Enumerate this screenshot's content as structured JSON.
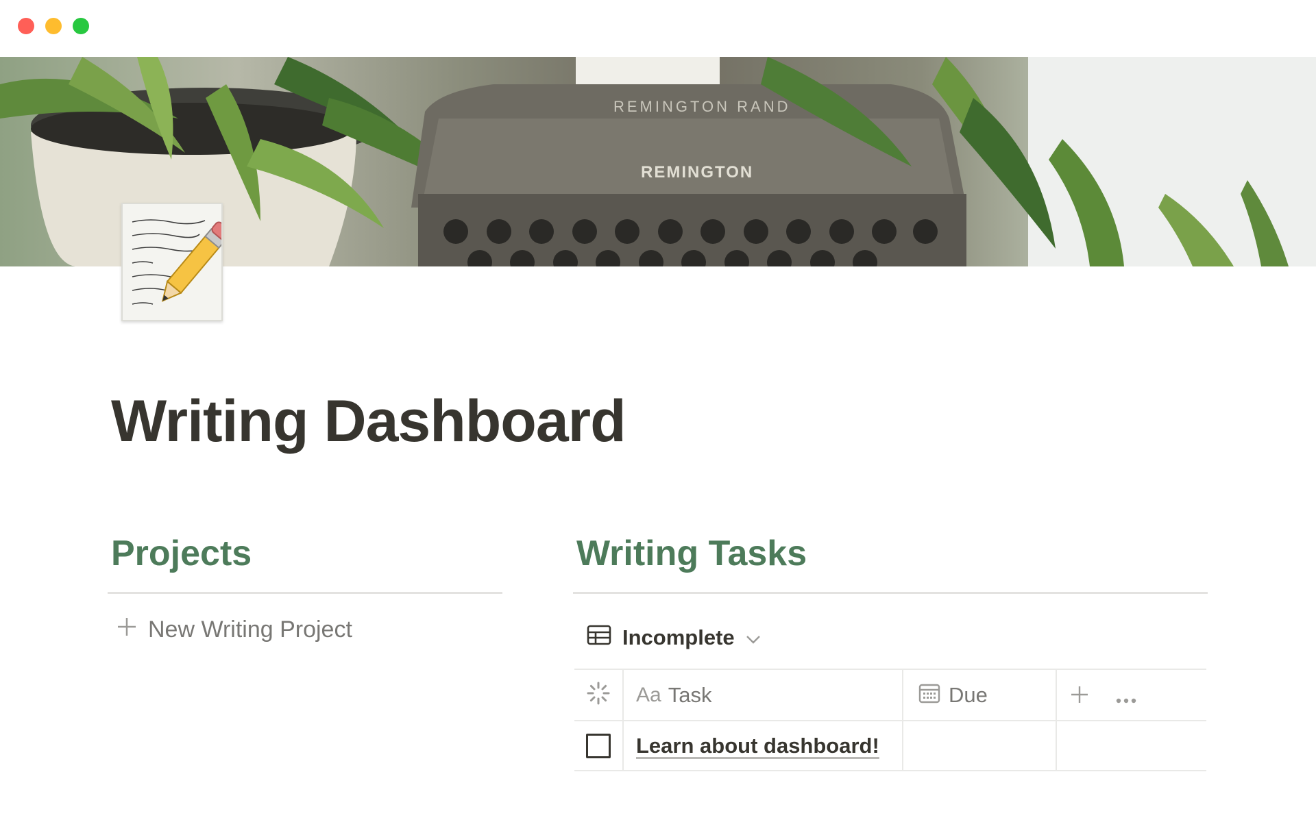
{
  "window": {
    "close_color": "#ff5f57",
    "minimize_color": "#febc2e",
    "maximize_color": "#28c840"
  },
  "cover": {
    "text_top": "REMINGTON RAND",
    "text_front": "REMINGTON"
  },
  "page_icon": {
    "name": "memo-icon"
  },
  "page": {
    "title": "Writing Dashboard"
  },
  "projects": {
    "title": "Projects",
    "new_label": "New Writing Project"
  },
  "tasks": {
    "title": "Writing Tasks",
    "view_label": "Incomplete",
    "columns": {
      "task_prefix": "Aa",
      "task": "Task",
      "due": "Due"
    },
    "rows": [
      {
        "task": "Learn about dashboard!",
        "due": "",
        "checked": false
      }
    ]
  },
  "accent_color": "#4d7b5a"
}
